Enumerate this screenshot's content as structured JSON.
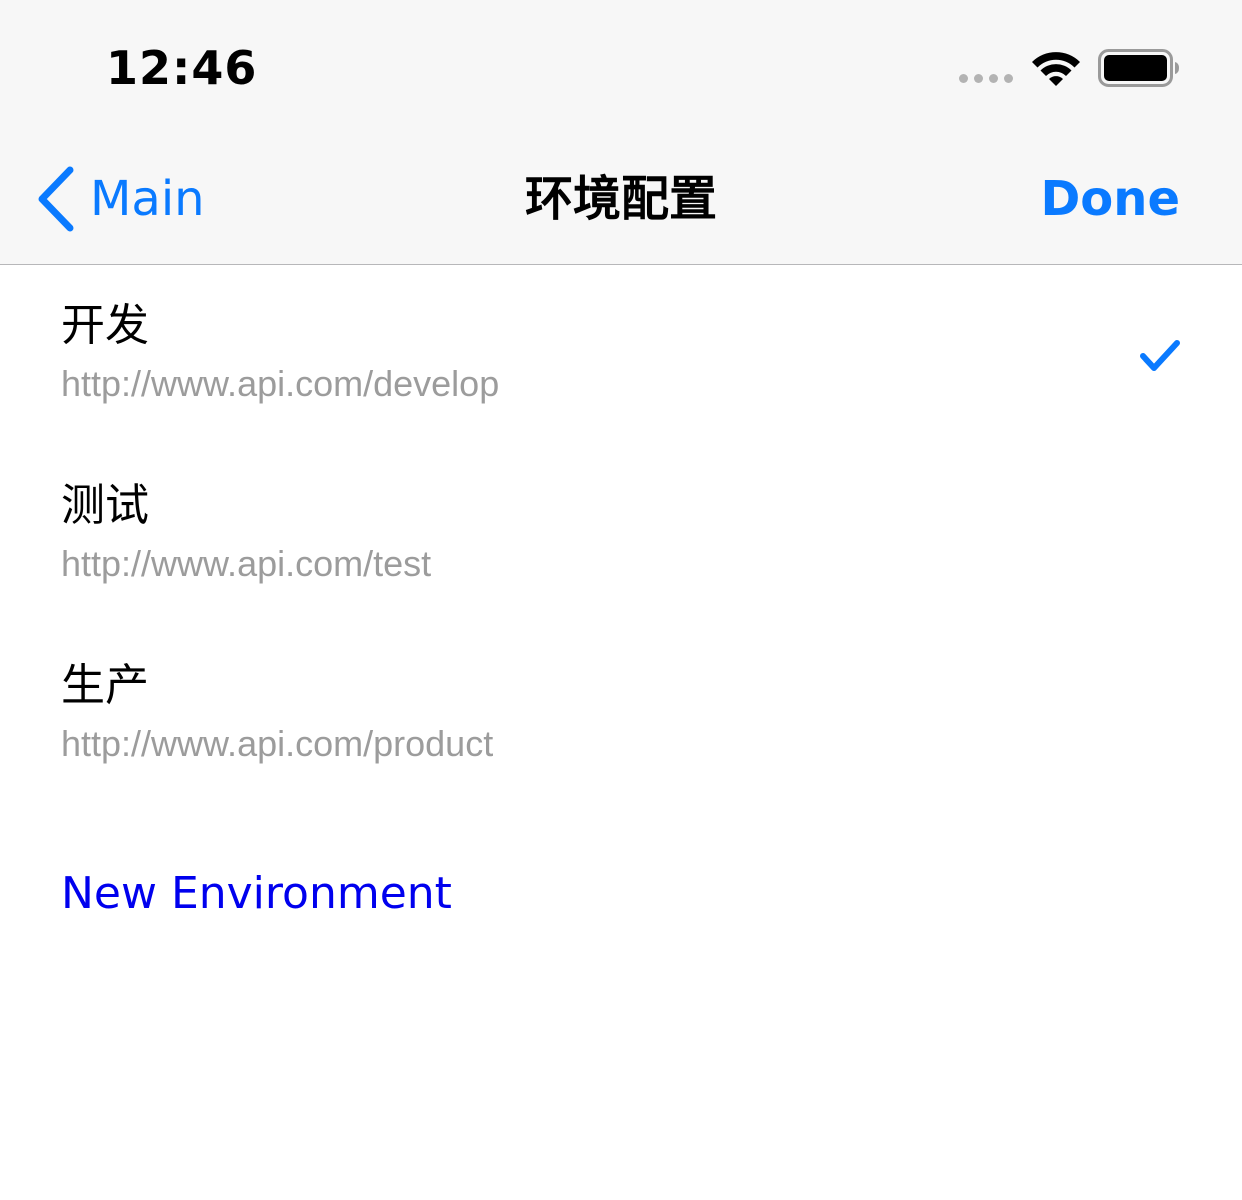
{
  "status_bar": {
    "time": "12:46",
    "signal_icon": "signal-dots-icon",
    "wifi_icon": "wifi-icon",
    "battery_icon": "battery-icon"
  },
  "nav": {
    "back_label": "Main",
    "title": "环境配置",
    "done_label": "Done"
  },
  "environments": [
    {
      "name": "开发",
      "url": "http://www.api.com/develop",
      "selected": true
    },
    {
      "name": "测试",
      "url": "http://www.api.com/test",
      "selected": false
    },
    {
      "name": "生产",
      "url": "http://www.api.com/product",
      "selected": false
    }
  ],
  "actions": {
    "new_environment_label": "New Environment"
  },
  "colors": {
    "accent": "#0a7aff",
    "link": "#0000ee",
    "secondary_text": "#9c9c9c",
    "bar_background": "#f7f7f7"
  }
}
